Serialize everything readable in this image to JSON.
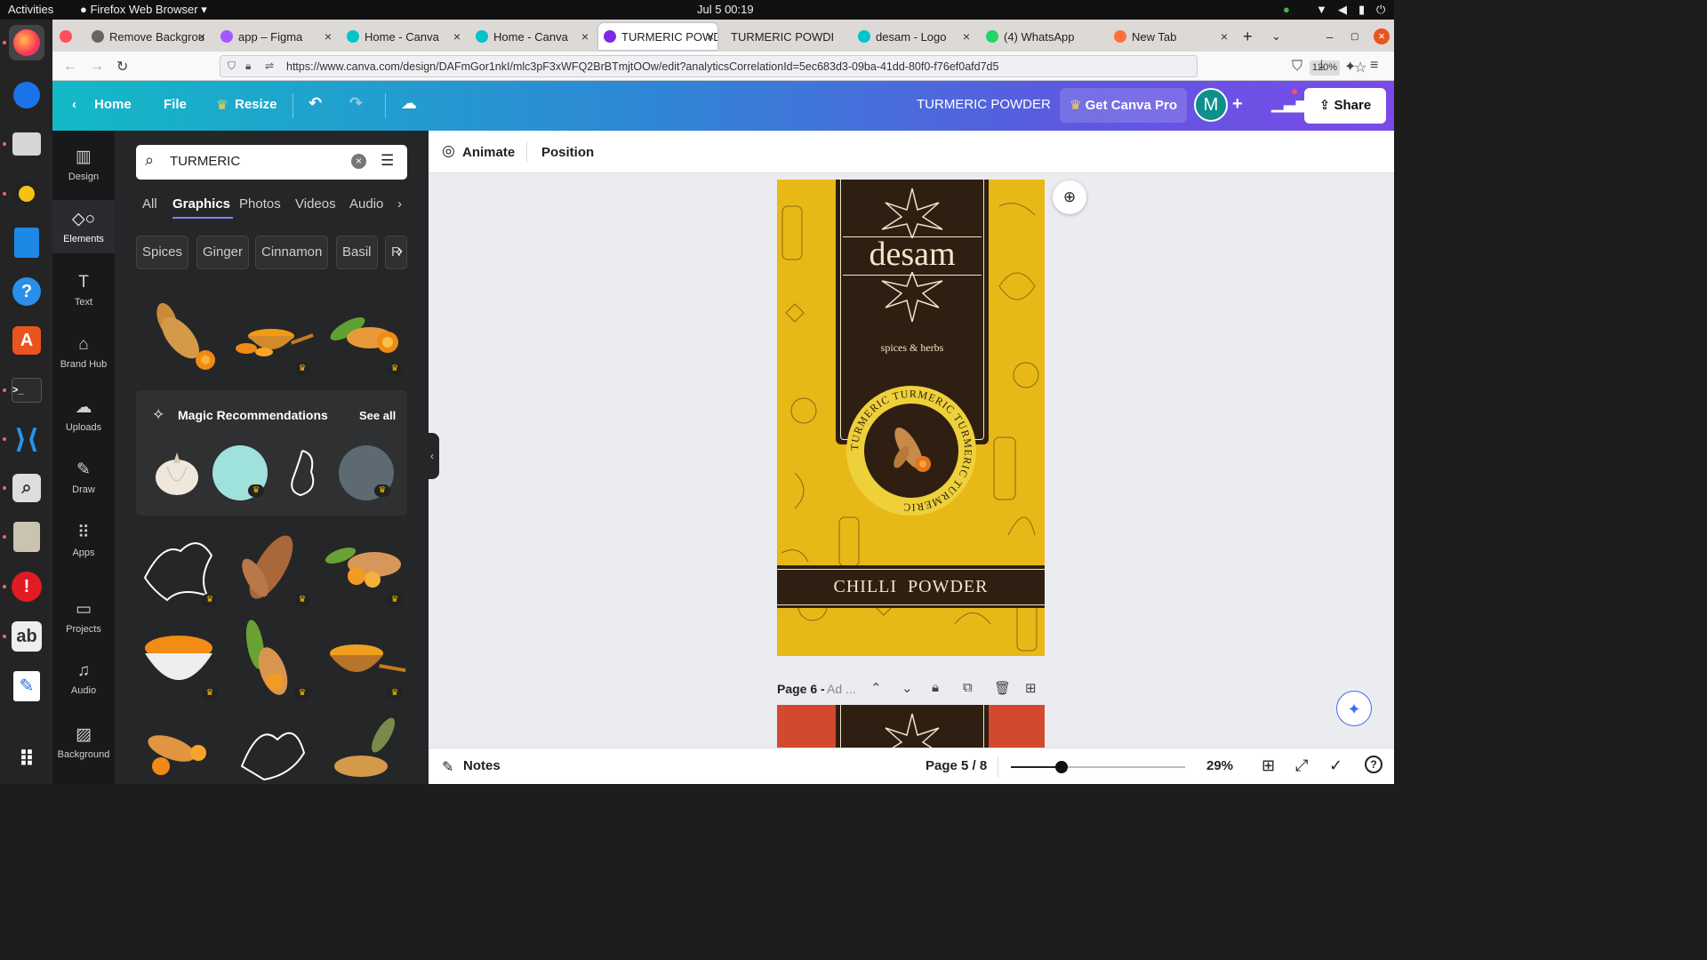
{
  "system": {
    "activities": "Activities",
    "app_name": "Firefox Web Browser",
    "datetime": "Jul 5  00:19"
  },
  "tabs": [
    {
      "label": "Remove Backgrou",
      "color": "#555"
    },
    {
      "label": "app – Figma",
      "color": "#a259ff"
    },
    {
      "label": "Home - Canva",
      "color": "#00c4cc"
    },
    {
      "label": "Home - Canva",
      "color": "#00c4cc"
    },
    {
      "label": "TURMERIC POWD",
      "color": "#7d2ae8"
    },
    {
      "label": "TURMERIC POWDER",
      "color": "#7d2ae8"
    },
    {
      "label": "desam - Logo",
      "color": "#00c4cc"
    },
    {
      "label": "(4) WhatsApp",
      "color": "#25d366"
    },
    {
      "label": "New Tab",
      "color": "#ff7139"
    }
  ],
  "url": {
    "text": "https://www.canva.com/design/DAFmGor1nkI/mlc3pF3xWFQ2BrBTmjtOOw/edit?analyticsCorrelationId=5ec683d3-09ba-41dd-80f0-f76ef0afd7d5",
    "zoom": "120%"
  },
  "header": {
    "home": "Home",
    "file": "File",
    "resize": "Resize",
    "doc_title": "TURMERIC POWDER",
    "get_pro": "Get Canva Pro",
    "avatar": "M",
    "share": "Share"
  },
  "rail": [
    "Design",
    "Elements",
    "Text",
    "Brand Hub",
    "Uploads",
    "Draw",
    "Apps",
    "Projects",
    "Audio",
    "Background"
  ],
  "panel": {
    "search_value": "TURMERIC",
    "tabs": [
      "All",
      "Graphics",
      "Photos",
      "Videos",
      "Audio"
    ],
    "chips": [
      "Spices",
      "Ginger",
      "Cinnamon",
      "Basil",
      "R"
    ],
    "magic_title": "Magic Recommendations",
    "see_all": "See all"
  },
  "editor": {
    "animate": "Animate",
    "position": "Position",
    "page6_label": "Page 6 - ",
    "page6_hint": "Ad ..."
  },
  "design": {
    "brand": "desam",
    "tagline": "spices & herbs",
    "ring_text": "TURMERIC TURMERIC TURMERIC TURMERIC",
    "product": "CHILLI  POWDER",
    "colors": {
      "background": "#e8b817",
      "panel": "#2e1f12",
      "text": "#f3e6c9"
    }
  },
  "footer": {
    "notes": "Notes",
    "page": "Page 5 / 8",
    "zoom": "29%",
    "zoom_level": 0.29
  }
}
